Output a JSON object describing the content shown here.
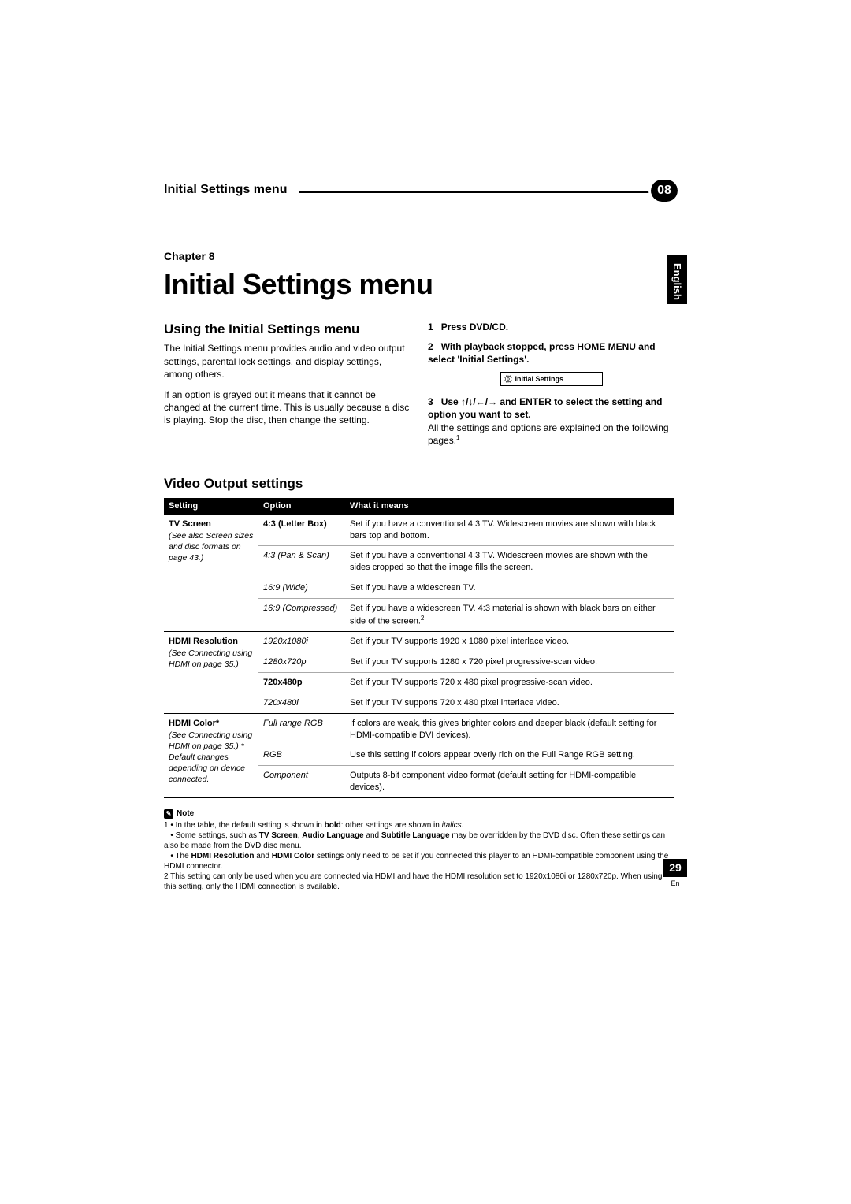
{
  "header": {
    "band_title": "Initial Settings menu",
    "chapter_num": "08"
  },
  "language_tab": "English",
  "chapter": {
    "label": "Chapter 8",
    "title": "Initial Settings menu"
  },
  "left_col": {
    "heading": "Using the Initial Settings menu",
    "p1": "The Initial Settings menu provides audio and video output settings, parental lock settings, and display settings, among others.",
    "p2": "If an option is grayed out it means that it cannot be changed at the current time. This is usually because a disc is playing. Stop the disc, then change the setting."
  },
  "right_col": {
    "step1_num": "1",
    "step1": "Press DVD/CD.",
    "step2_num": "2",
    "step2": "With playback stopped, press HOME MENU and select 'Initial Settings'.",
    "osd_label": "Initial Settings",
    "step3_num": "3",
    "step3_a": "Use ",
    "step3_arrows": "↑/↓/←/→",
    "step3_b": " and ENTER to select the setting and option you want to set.",
    "step3_desc": "All the settings and options are explained on the following pages.",
    "step3_footref": "1"
  },
  "video_output": {
    "heading": "Video Output settings",
    "columns": {
      "setting": "Setting",
      "option": "Option",
      "meaning": "What it means"
    },
    "groups": [
      {
        "setting_title": "TV Screen",
        "setting_note": "(See also Screen sizes and disc formats on page 43.)",
        "rows": [
          {
            "option": "4:3 (Letter Box)",
            "style": "bold",
            "meaning": "Set if you have a conventional 4:3 TV. Widescreen movies are shown with black bars top and bottom."
          },
          {
            "option": "4:3 (Pan & Scan)",
            "style": "italic",
            "meaning": "Set if you have a conventional 4:3 TV. Widescreen movies are shown with the sides cropped so that the image fills the screen."
          },
          {
            "option": "16:9 (Wide)",
            "style": "italic",
            "meaning": "Set if you have a widescreen TV."
          },
          {
            "option": "16:9 (Compressed)",
            "style": "italic",
            "meaning": "Set if you have a widescreen TV. 4:3 material is shown with black bars on either side of the screen.",
            "footref": "2"
          }
        ]
      },
      {
        "setting_title": "HDMI Resolution",
        "setting_note": "(See Connecting using HDMI on page 35.)",
        "rows": [
          {
            "option": "1920x1080i",
            "style": "italic",
            "meaning": "Set if your TV supports 1920 x 1080 pixel interlace video."
          },
          {
            "option": "1280x720p",
            "style": "italic",
            "meaning": "Set if your TV supports 1280 x 720 pixel progressive-scan video."
          },
          {
            "option": "720x480p",
            "style": "bold",
            "meaning": "Set if your TV supports 720 x 480 pixel progressive-scan video."
          },
          {
            "option": "720x480i",
            "style": "italic",
            "meaning": "Set if your TV supports 720 x 480 pixel interlace video."
          }
        ]
      },
      {
        "setting_title": "HDMI Color*",
        "setting_note": "(See Connecting using HDMI on page 35.)\n* Default changes depending on device connected.",
        "rows": [
          {
            "option": "Full range RGB",
            "style": "italic",
            "meaning": "If colors are weak, this gives brighter colors and deeper black (default setting for HDMI-compatible DVI devices)."
          },
          {
            "option": "RGB",
            "style": "italic",
            "meaning": "Use this setting if colors appear overly rich on the Full Range RGB setting."
          },
          {
            "option": "Component",
            "style": "italic",
            "meaning": "Outputs 8-bit component video format (default setting for HDMI-compatible devices)."
          }
        ]
      }
    ]
  },
  "notes": {
    "label": "Note",
    "n1a": "1 • In the table, the default setting is shown in ",
    "n1b_bold": "bold",
    "n1c": ": other settings are shown in ",
    "n1d_italic": "italics",
    "n1e": ".",
    "n1f": "• Some settings, such as ",
    "n1g_b1": "TV Screen",
    "n1h": ", ",
    "n1i_b2": "Audio Language",
    "n1j": " and ",
    "n1k_b3": "Subtitle Language",
    "n1l": " may be overridden by the DVD disc. Often these settings can also be made from the DVD disc menu.",
    "n1m": "• The ",
    "n1n_b4": "HDMI Resolution",
    "n1o": " and ",
    "n1p_b5": "HDMI Color",
    "n1q": " settings only need to be set if you connected this player to an HDMI-compatible component using the HDMI connector.",
    "n2": "2 This setting can only be used when you are connected via HDMI and have the HDMI resolution set to 1920x1080i or 1280x720p. When using this setting, only the HDMI connection is available."
  },
  "footer": {
    "page": "29",
    "locale": "En"
  }
}
